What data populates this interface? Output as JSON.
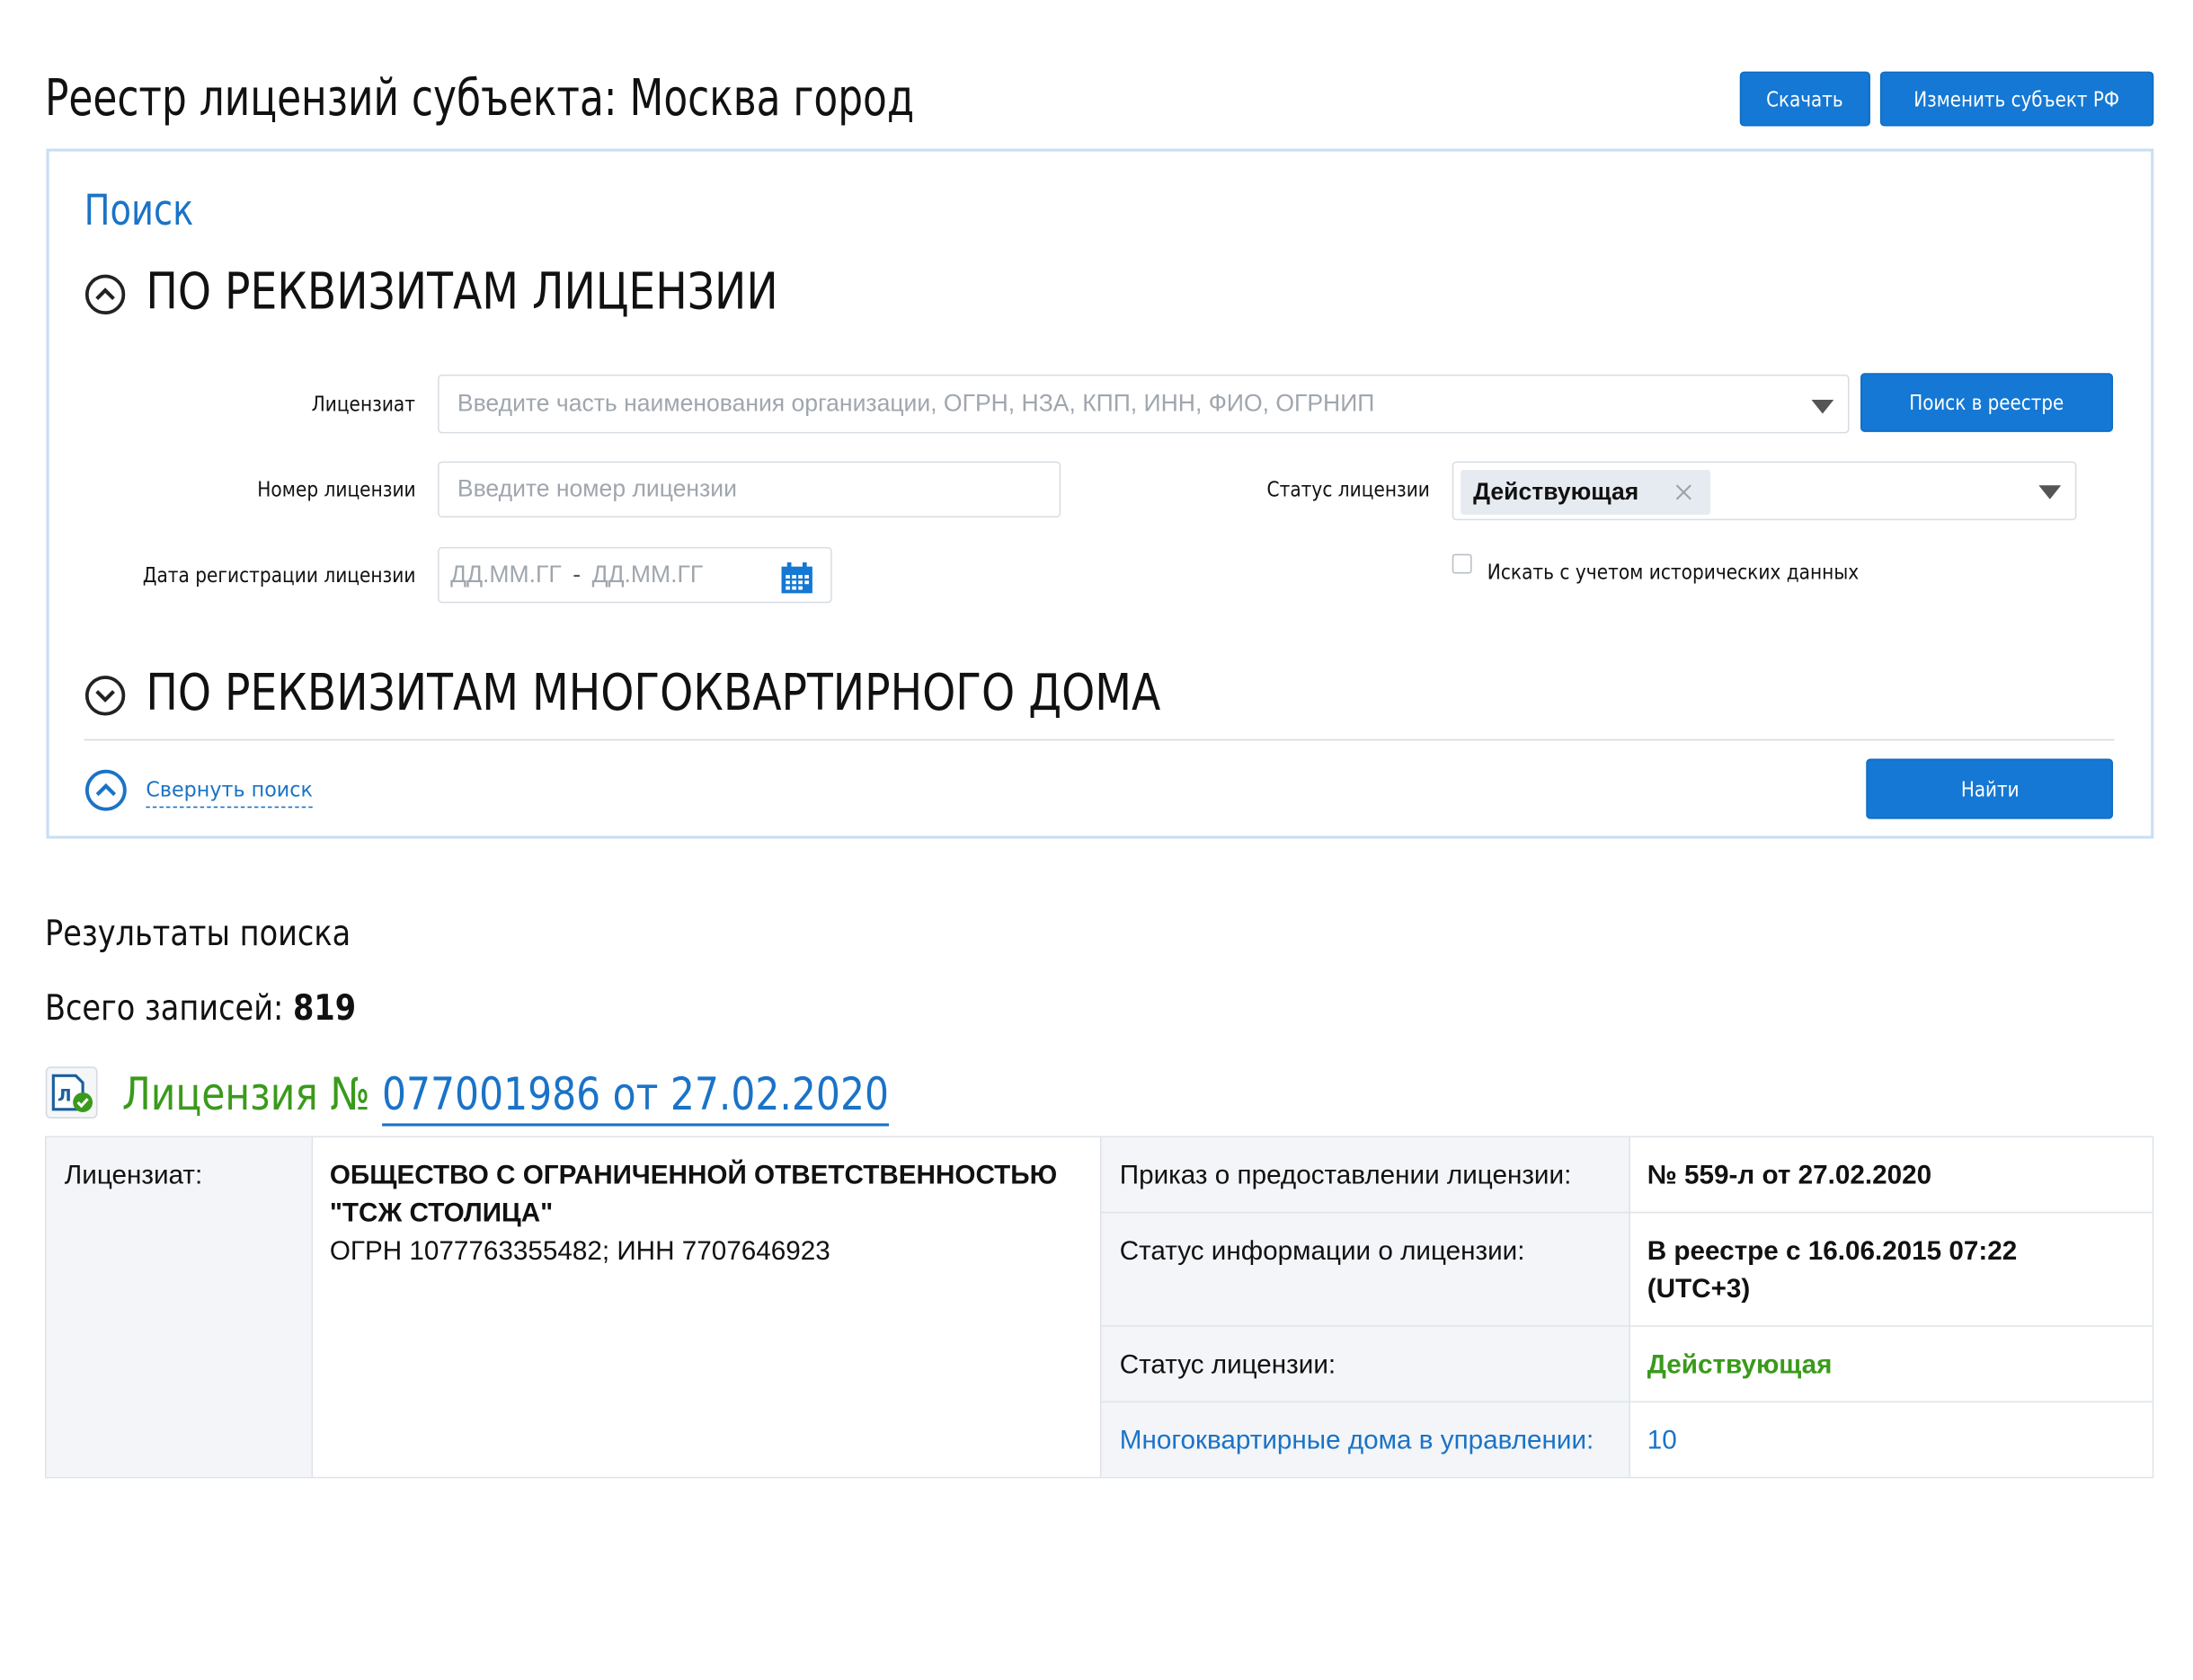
{
  "header": {
    "title": "Реестр лицензий субъекта: Москва город",
    "download_button": "Скачать",
    "change_region_button": "Изменить субъект РФ"
  },
  "search": {
    "title": "Поиск",
    "section_license": "ПО РЕКВИЗИТАМ ЛИЦЕНЗИИ",
    "section_house": "ПО РЕКВИЗИТАМ МНОГОКВАРТИРНОГО ДОМА",
    "licensee_label": "Лицензиат",
    "licensee_placeholder": "Введите часть наименования организации, ОГРН, НЗА, КПП, ИНН, ФИО, ОГРНИП",
    "search_registry_button": "Поиск в реестре",
    "number_label": "Номер лицензии",
    "number_placeholder": "Введите номер лицензии",
    "status_label": "Статус лицензии",
    "status_value": "Действующая",
    "date_label": "Дата регистрации лицензии",
    "date_from_placeholder": "ДД.ММ.ГГ",
    "date_separator": "-",
    "date_to_placeholder": "ДД.ММ.ГГ",
    "history_checkbox_label": "Искать с учетом исторических данных",
    "history_checked": false,
    "collapse_link": "Свернуть поиск",
    "find_button": "Найти"
  },
  "results": {
    "heading": "Результаты поиска",
    "total_label": "Всего записей:",
    "total_value": "819",
    "license": {
      "title_prefix": "Лицензия №",
      "title_link": "077001986 от 27.02.2020",
      "licensee_label": "Лицензиат:",
      "licensee_name_line1": "ОБЩЕСТВО С ОГРАНИЧЕННОЙ ОТВЕТСТВЕННОСТЬЮ",
      "licensee_name_line2": "\"ТСЖ СТОЛИЦА\"",
      "licensee_ids": "ОГРН 1077763355482; ИНН 7707646923",
      "order_label": "Приказ о предоставлении лицензии:",
      "order_value": "№ 559-л от 27.02.2020",
      "info_status_label": "Статус информации о лицензии:",
      "info_status_value_line1": "В реестре с 16.06.2015 07:22",
      "info_status_value_line2": "(UTC+3)",
      "status_label": "Статус лицензии:",
      "status_value": "Действующая",
      "houses_label": "Многоквартирные дома в управлении:",
      "houses_value": "10"
    }
  },
  "colors": {
    "primary_blue": "#1478d4",
    "link_blue": "#1a73c7",
    "active_green": "#3a9a1b",
    "panel_border": "#c9def3"
  },
  "icons": {
    "section_license_toggle": "chevron-up-circle-icon",
    "section_house_toggle": "chevron-down-circle-icon",
    "collapse": "chevron-up-circle-icon",
    "dropdown": "triangle-down-icon",
    "calendar": "calendar-icon",
    "tag_remove": "close-icon",
    "license_document": "license-document-check-icon"
  }
}
